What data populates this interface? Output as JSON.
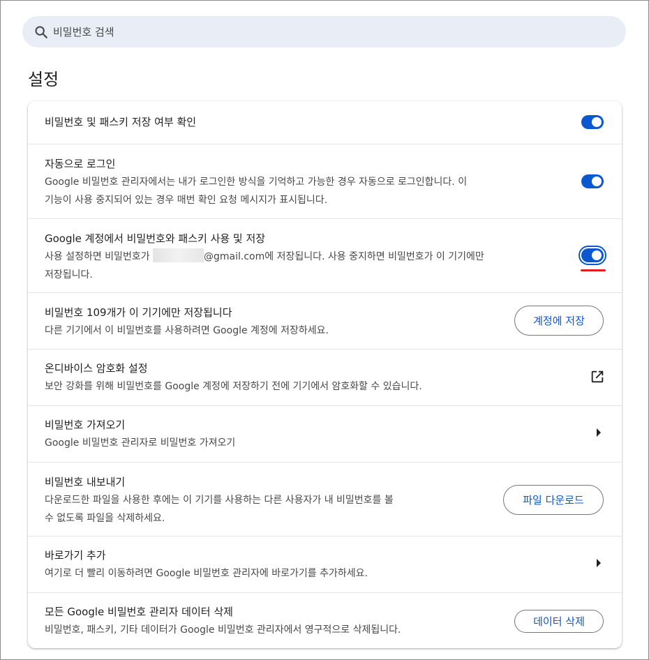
{
  "search": {
    "placeholder": "비밀번호 검색"
  },
  "page_title": "설정",
  "rows": [
    {
      "title": "비밀번호 및 패스키 저장 여부 확인",
      "toggle_on": true
    },
    {
      "title": "자동으로 로그인",
      "desc_line1": "Google 비밀번호 관리자에서는 내가 로그인한 방식을 기억하고 가능한 경우 자동으로 로그인합니다. 이",
      "desc_line2": "기능이 사용 중지되어 있는 경우 매번 확인 요청 메시지가 표시됩니다.",
      "toggle_on": true
    },
    {
      "title": "Google 계정에서 비밀번호와 패스키 사용 및 저장",
      "desc_prefix": "사용 설정하면 비밀번호가 ",
      "desc_suffix": "@gmail.com에 저장됩니다. 사용 중지하면 비밀번호가 이 기기에만",
      "desc_line2": "저장됩니다.",
      "toggle_on": true
    },
    {
      "title": "비밀번호 109개가 이 기기에만 저장됩니다",
      "desc_line1": "다른 기기에서 이 비밀번호를 사용하려면 Google 계정에 저장하세요.",
      "button_label": "계정에 저장"
    },
    {
      "title": "온디바이스 암호화 설정",
      "desc_line1": "보안 강화를 위해 비밀번호를 Google 계정에 저장하기 전에 기기에서 암호화할 수 있습니다.",
      "icon": "open-in-new-icon"
    },
    {
      "title": "비밀번호 가져오기",
      "desc_line1": "Google 비밀번호 관리자로 비밀번호 가져오기",
      "icon": "arrow-right-icon"
    },
    {
      "title": "비밀번호 내보내기",
      "desc_line1": "다운로드한 파일을 사용한 후에는 이 기기를 사용하는 다른 사용자가 내 비밀번호를 볼",
      "desc_line2": "수 없도록 파일을 삭제하세요.",
      "button_label": "파일 다운로드"
    },
    {
      "title": "바로가기 추가",
      "desc_line1": "여기로 더 빨리 이동하려면 Google 비밀번호 관리자에 바로가기를 추가하세요.",
      "icon": "arrow-right-icon"
    },
    {
      "title": "모든 Google 비밀번호 관리자 데이터 삭제",
      "desc_line1": "비밀번호, 패스키, 기타 데이터가 Google 비밀번호 관리자에서 영구적으로 삭제됩니다.",
      "button_label": "데이터 삭제"
    }
  ],
  "colors": {
    "accent": "#0b57d0",
    "annotation": "#e0201a",
    "search_bg": "#e9eef6"
  }
}
